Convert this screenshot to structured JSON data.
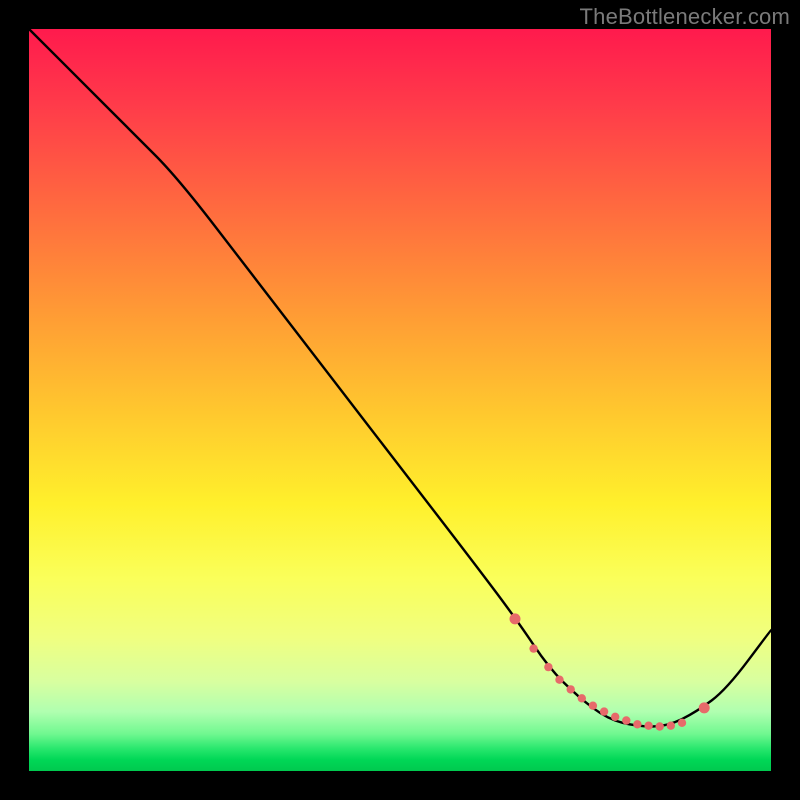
{
  "watermark": "TheBottlenecker.com",
  "chart_data": {
    "type": "line",
    "title": "",
    "xlabel": "",
    "ylabel": "",
    "xlim": [
      0,
      100
    ],
    "ylim": [
      0,
      100
    ],
    "series": [
      {
        "name": "bottleneck-curve",
        "x": [
          0,
          8,
          14,
          20,
          30,
          40,
          50,
          60,
          66,
          70,
          74,
          78,
          82,
          86,
          90,
          94,
          100
        ],
        "y": [
          100,
          92,
          86,
          80,
          67,
          54,
          41,
          28,
          20,
          14,
          10,
          7,
          6,
          6,
          8,
          11,
          19
        ]
      }
    ],
    "highlight_points": {
      "name": "valley-dots",
      "color": "#e76a6a",
      "x": [
        65.5,
        68,
        70,
        71.5,
        73,
        74.5,
        76,
        77.5,
        79,
        80.5,
        82,
        83.5,
        85,
        86.5,
        88,
        91
      ],
      "y": [
        20.5,
        16.5,
        14,
        12.3,
        11,
        9.8,
        8.8,
        8,
        7.3,
        6.8,
        6.3,
        6.1,
        6,
        6.1,
        6.5,
        8.5
      ]
    },
    "gradient_stops": [
      {
        "pos": 0,
        "color": "#ff1a4d"
      },
      {
        "pos": 0.52,
        "color": "#ffe82e"
      },
      {
        "pos": 0.82,
        "color": "#f0ff80"
      },
      {
        "pos": 1.0,
        "color": "#00c94f"
      }
    ]
  }
}
